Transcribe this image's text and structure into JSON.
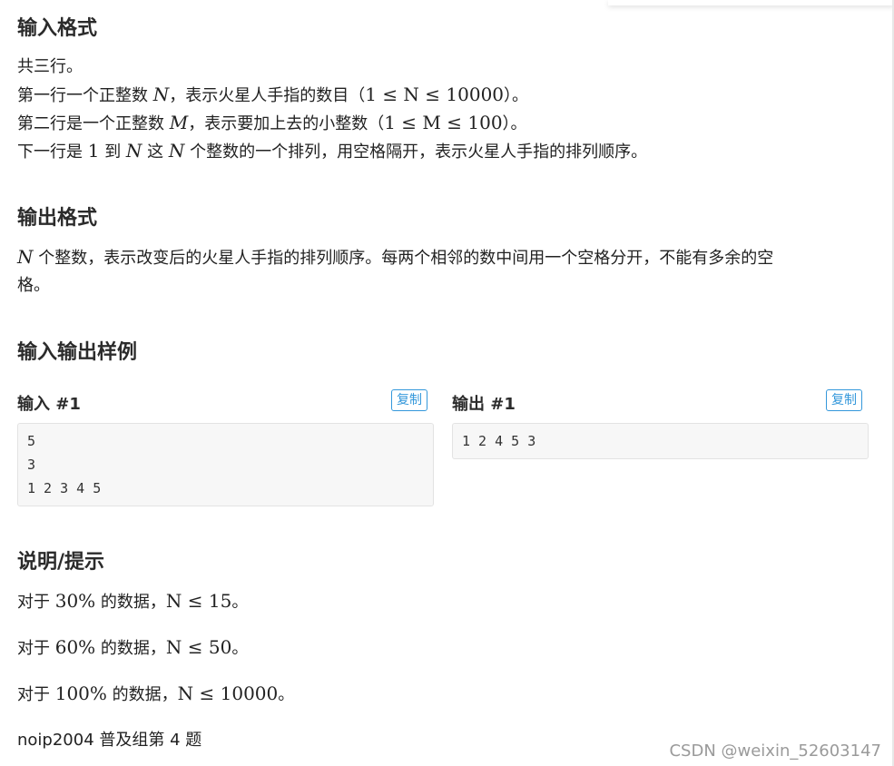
{
  "sections": {
    "input_format_title": "输入格式",
    "input_format": {
      "line1": "共三行。",
      "line2_a": "第一行一个正整数 ",
      "line2_var": "N",
      "line2_b": "，表示火星人手指的数目（",
      "line2_range": "1 ≤ N ≤ 10000",
      "line2_c": "）。",
      "line3_a": "第二行是一个正整数 ",
      "line3_var": "M",
      "line3_b": "，表示要加上去的小整数（",
      "line3_range": "1 ≤ M ≤ 100",
      "line3_c": "）。",
      "line4_a": "下一行是 ",
      "line4_1": "1",
      "line4_b": " 到 ",
      "line4_var1": "N",
      "line4_c": " 这 ",
      "line4_var2": "N",
      "line4_d": " 个整数的一个排列，用空格隔开，表示火星人手指的排列顺序。"
    },
    "output_format_title": "输出格式",
    "output_format": {
      "var": "N",
      "line1": " 个整数，表示改变后的火星人手指的排列顺序。每两个相邻的数中间用一个空格分开，不能有多余的空",
      "line2": "格。"
    },
    "samples_title": "输入输出样例",
    "samples": {
      "input_title": "输入 #1",
      "output_title": "输出 #1",
      "copy_label": "复制",
      "input_lines": [
        "5",
        "3",
        "1 2 3 4 5"
      ],
      "output_lines": [
        "1 2 4 5 3"
      ]
    },
    "hint_title": "说明/提示",
    "hints": [
      {
        "a": "对于 ",
        "pct": "30%",
        "b": " 的数据，",
        "cond": "N ≤ 15",
        "c": "。"
      },
      {
        "a": "对于 ",
        "pct": "60%",
        "b": " 的数据，",
        "cond": "N ≤ 50",
        "c": "。"
      },
      {
        "a": "对于 ",
        "pct": "100%",
        "b": " 的数据，",
        "cond": "N ≤ 10000",
        "c": "。"
      }
    ],
    "source": "noip2004 普及组第 4 题"
  },
  "watermark": "CSDN @weixin_52603147",
  "colors": {
    "accent": "#3498db",
    "code_bg": "#f7f7f7"
  }
}
